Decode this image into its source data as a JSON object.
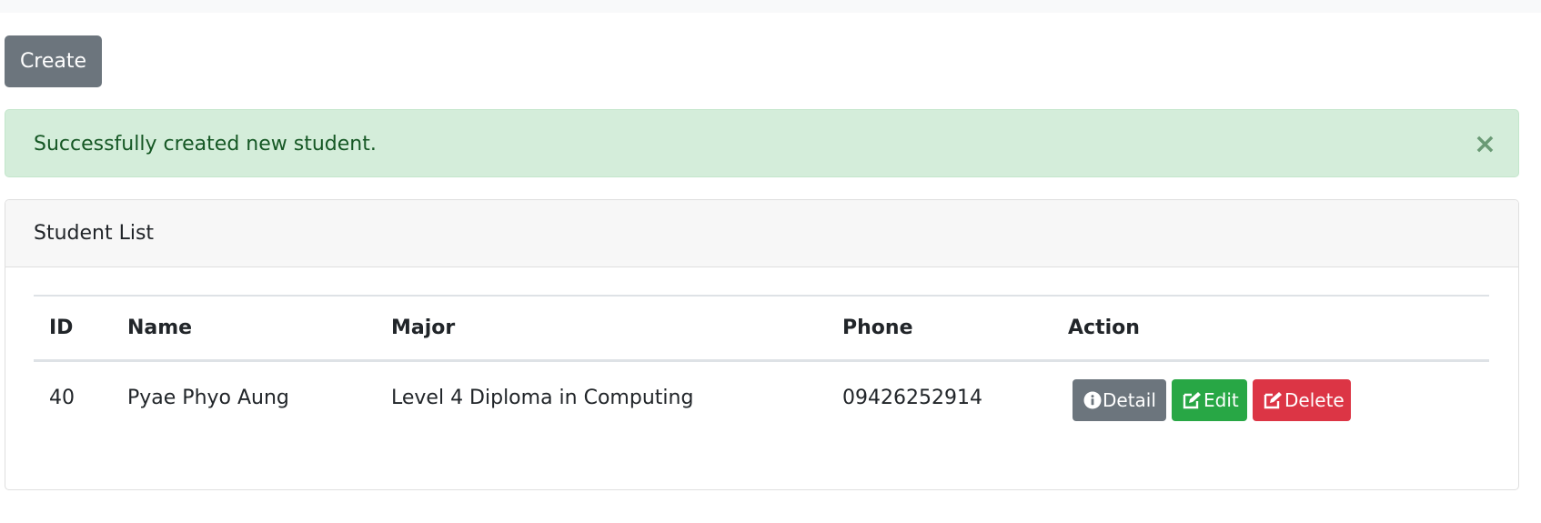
{
  "toolbar": {
    "create_label": "Create"
  },
  "alert": {
    "message": "Successfully created new student.",
    "close_glyph": "×"
  },
  "card": {
    "title": "Student List"
  },
  "table": {
    "columns": [
      "ID",
      "Name",
      "Major",
      "Phone",
      "Action"
    ],
    "rows": [
      {
        "id": "40",
        "name": "Pyae Phyo Aung",
        "major": "Level 4 Diploma in Computing",
        "phone": "09426252914",
        "actions": {
          "detail": "Detail",
          "edit": "Edit",
          "delete": "Delete"
        }
      }
    ]
  },
  "icons": {
    "detail": "info-circle-icon",
    "edit": "edit-icon",
    "delete": "edit-icon"
  },
  "colors": {
    "secondary": "#6c757d",
    "success": "#28a745",
    "danger": "#dc3545",
    "alert_bg": "#d4edda",
    "alert_text": "#155724"
  }
}
